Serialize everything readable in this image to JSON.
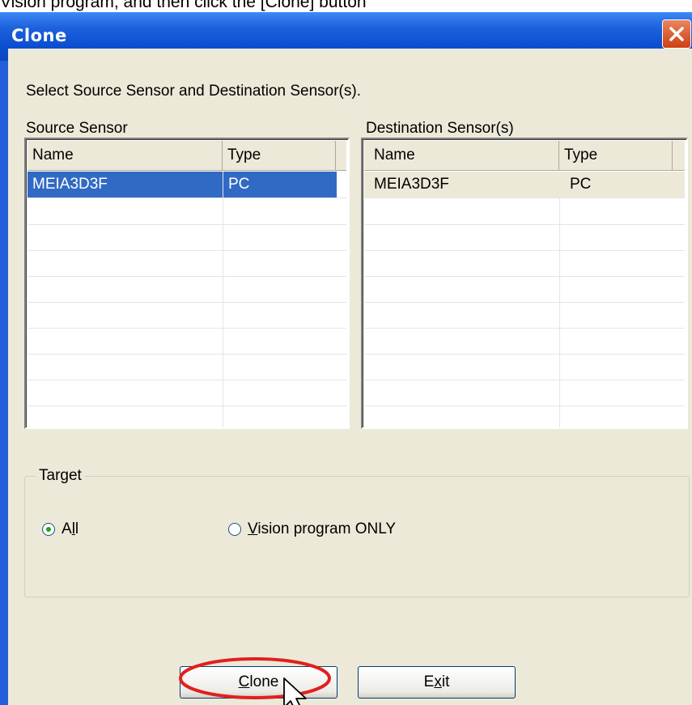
{
  "caption": "Vision program, and then click the [Clone] button",
  "window": {
    "title": "Clone"
  },
  "instruction": "Select Source Sensor and Destination Sensor(s).",
  "source": {
    "label": "Source Sensor",
    "columns": [
      "Name",
      "Type"
    ],
    "rows": [
      {
        "name": "MEIA3D3F",
        "type": "PC",
        "selected": true
      }
    ]
  },
  "destination": {
    "label": "Destination Sensor(s)",
    "columns": [
      "Name",
      "Type"
    ],
    "rows": [
      {
        "name": "MEIA3D3F",
        "type": "PC",
        "selected": false
      }
    ]
  },
  "target": {
    "label": "Target",
    "options": [
      {
        "label": "All",
        "mnemonic": "l",
        "checked": true
      },
      {
        "label": "Vision program ONLY",
        "mnemonic": "V",
        "checked": false
      }
    ]
  },
  "buttons": {
    "clone": "Clone",
    "exit": "Exit"
  },
  "colors": {
    "selection": "#316ac5",
    "titlebar": "#0a4fd0",
    "annotation": "#e0201e"
  }
}
